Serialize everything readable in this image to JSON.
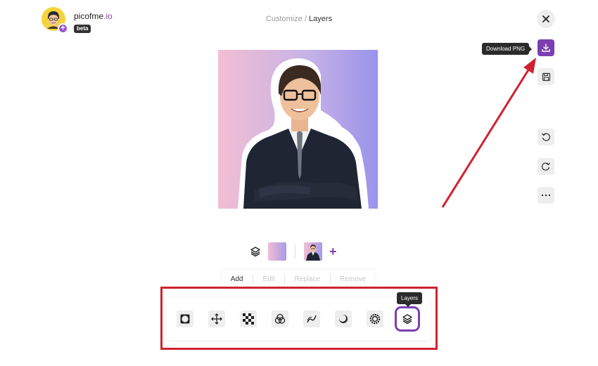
{
  "brand": {
    "name_main": "picofme",
    "name_accent": ".io",
    "badge": "beta"
  },
  "breadcrumb": {
    "parent": "Customize",
    "separator": " / ",
    "current": "Layers"
  },
  "header": {
    "close_icon": "close-icon"
  },
  "toolbar": {
    "download_tooltip": "Download PNG",
    "items": [
      "download-icon",
      "save-icon",
      "undo-icon",
      "redo-icon",
      "more-icon"
    ]
  },
  "layers": {
    "icon": "layers-icon",
    "add_label": "+"
  },
  "tabs": [
    {
      "label": "Add",
      "state": "active"
    },
    {
      "label": "Edit",
      "state": "disabled"
    },
    {
      "label": "Replace",
      "state": "disabled"
    },
    {
      "label": "Remove",
      "state": "disabled"
    }
  ],
  "tools": {
    "items": [
      "frame-icon",
      "move-icon",
      "transparency-icon",
      "blend-icon",
      "curve-icon",
      "shadow-icon",
      "settings-icon",
      "layers-icon"
    ],
    "selected": "layers-icon",
    "selected_tooltip": "Layers"
  },
  "colors": {
    "accent": "#7b3fb0",
    "highlight": "#d0222e",
    "gradient_start": "#f2bed3",
    "gradient_end": "#9a93ea"
  }
}
